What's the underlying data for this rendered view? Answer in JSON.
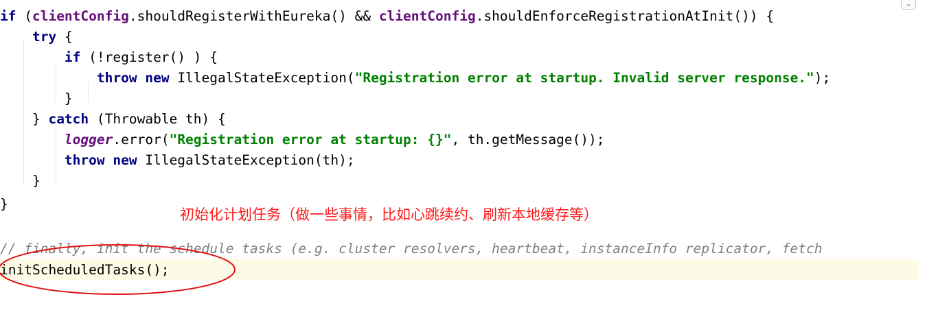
{
  "code": {
    "l1": {
      "if": "if",
      "p1": " (",
      "cc1": "clientConfig",
      "p2": ".shouldRegisterWithEureka() && ",
      "cc2": "clientConfig",
      "p3": ".shouldEnforceRegistrationAtInit()) {"
    },
    "l2": {
      "indent": "    ",
      "try": "try",
      "p1": " {"
    },
    "l3": {
      "indent": "        ",
      "if": "if",
      "p1": " (!register() ) {"
    },
    "l4": {
      "indent": "            ",
      "throw": "throw",
      "sp": " ",
      "new": "new",
      "p1": " IllegalStateException(",
      "str": "\"Registration error at startup. Invalid server response.\"",
      "p2": ");"
    },
    "l5": {
      "text": "        }"
    },
    "l6": {
      "p0": "    } ",
      "catch": "catch",
      "p1": " (Throwable th) {"
    },
    "l7": {
      "indent": "        ",
      "logger": "logger",
      "p1": ".error(",
      "str": "\"Registration error at startup: {}\"",
      "p2": ", th.getMessage());"
    },
    "l8": {
      "indent": "        ",
      "throw": "throw",
      "sp": " ",
      "new": "new",
      "p1": " IllegalStateException(th);"
    },
    "l9": {
      "text": "    }"
    },
    "l10": {
      "text": "}"
    },
    "l11": {
      "comment": "// finally, init the schedule tasks (e.g. cluster resolvers, heartbeat, instanceInfo replicator, fetch"
    },
    "l12": {
      "text": "initScheduledTasks();"
    }
  },
  "annotation": {
    "text": "初始化计划任务（做一些事情，比如心跳续约、刷新本地缓存等）",
    "color": "#ff1a1a"
  },
  "fold_button": {
    "icon": "chevron-down-icon",
    "glyph": "⌄"
  },
  "colors": {
    "keyword": "#000080",
    "field": "#660e7a",
    "string": "#008000",
    "comment": "#808080",
    "caret_row": "#fdfbe6",
    "highlight_circle": "#e01010"
  }
}
